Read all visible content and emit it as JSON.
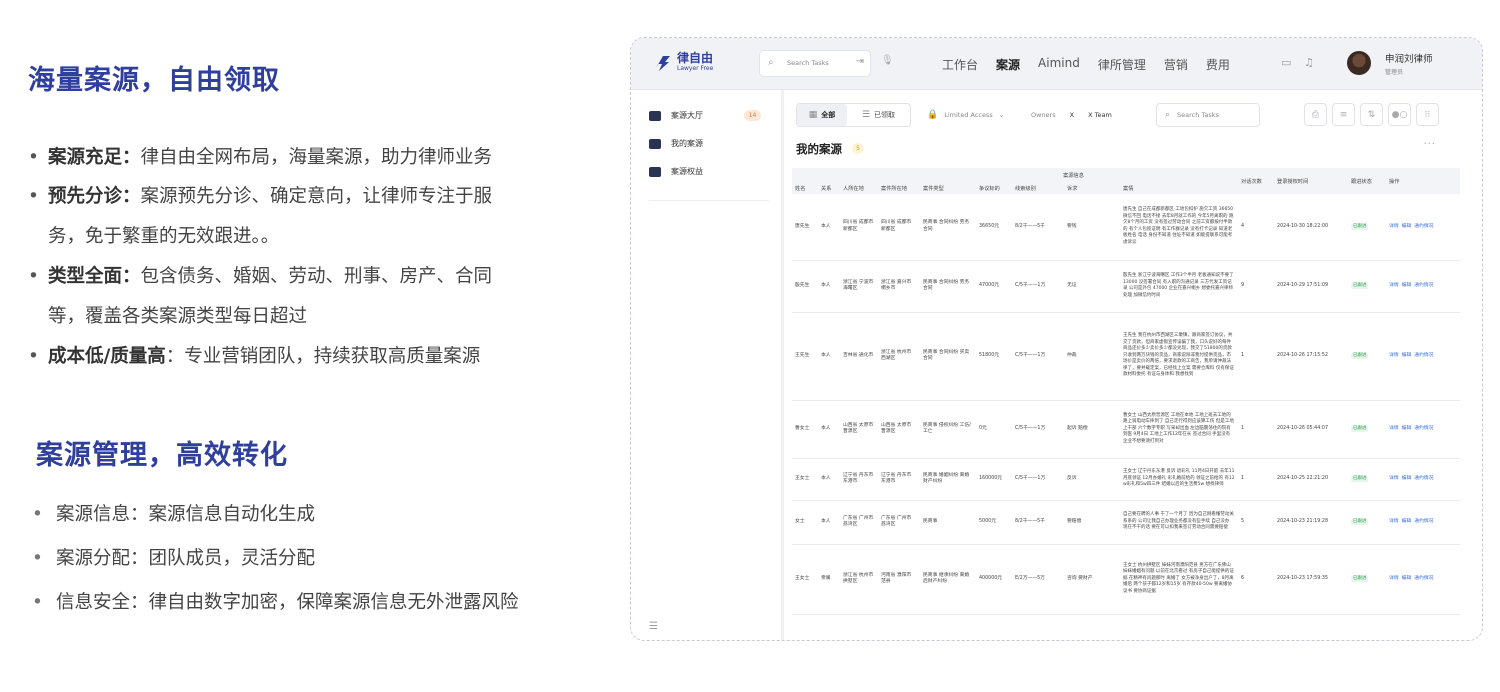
{
  "left": {
    "heading1": "海量案源，自由领取",
    "bullets": [
      {
        "bold": "案源充足：",
        "text": "律自由全网布局，海量案源，助力律师业务",
        "cont": ""
      },
      {
        "bold": "预先分诊：",
        "text": "案源预先分诊、确定意向，让律师专注于服",
        "cont": "务，免于繁重的无效跟进。。"
      },
      {
        "bold": "类型全面：",
        "text": "包含债务、婚姻、劳动、刑事、房产、合同",
        "cont": "等，覆盖各类案源类型每日超过"
      },
      {
        "bold": "成本低/质量高",
        "text": "：专业营销团队，持续获取高质量案源",
        "cont": ""
      }
    ],
    "heading2": "案源管理，高效转化",
    "sub_bullets": [
      "案源信息：案源信息自动化生成",
      "案源分配：团队成员，灵活分配",
      "信息安全：律自由数字加密，保障案源信息无外泄露风险"
    ]
  },
  "app": {
    "logo_name": "律自由",
    "logo_sub": "Lawyer Free",
    "search_placeholder": "Search Tasks",
    "nav": [
      "工作台",
      "案源",
      "Aimind",
      "律所管理",
      "营销",
      "费用"
    ],
    "user_name": "申润刘律师",
    "user_role": "管理员",
    "sidebar": [
      {
        "label": "案源大厅",
        "badge": "14"
      },
      {
        "label": "我的案源"
      },
      {
        "label": "案源权益"
      }
    ],
    "filters": {
      "all": "全部",
      "claimed": "已领取",
      "limited": "Limited Access",
      "owners": "Owners",
      "x": "X",
      "team": "X Team",
      "search_placeholder": "Search Tasks"
    },
    "title": "我的案源",
    "count": "5",
    "table": {
      "group_header": "案源信息",
      "headers": [
        "姓名",
        "关系",
        "人所在地",
        "案件所在地",
        "案件类型",
        "争议标的",
        "线索级别",
        "诉求",
        "案情",
        "对话次数",
        "登录授权时间",
        "跟进状态",
        "操作"
      ],
      "rows": [
        {
          "name": "唐先生",
          "rel": "本人",
          "loc": "四川省 成都市 新都区",
          "case_loc": "四川省 成都市 新都区",
          "type": "民商事 合同纠纷 劳务合同",
          "amount": "36650元",
          "level": "8/2千——5千",
          "demand": "要钱",
          "desc": "唐先生 自己在成都新都区 工地包扣护 施欠工资 36650 微信不回 电话不接 去年8月就工作的 今年5月离职的 跑欠8个月的工资 没有签过劳动合同 之前工资都按付半款的 有个人包揽证明 有工作群记录 没有打卡记录 知道老板姓名 电话 身份不知道 住址不知道 如能提联系可能考虑诉讼",
          "talks": "4",
          "time": "2024-10-30 18:22:00",
          "status": "已跟进",
          "ops": [
            "详情",
            "编辑",
            "通约情况"
          ]
        },
        {
          "name": "殷先生",
          "rel": "本人",
          "loc": "浙江省 宁波市 海曙区",
          "case_loc": "浙江省 嘉兴市 桐乡市",
          "type": "民商事 合同纠纷 劳务合同",
          "amount": "47000元",
          "level": "C/5千——1万",
          "demand": "无证",
          "desc": "殷先生 浙江宁波海曙区 工作3个半月 老板通知说不要了 13000 没签署合同 有入职的沟通记录 三方代发工资记录 公司是外包 47000 企业在嘉兴桐乡 想委托嘉兴律师处理 加微信约时间",
          "talks": "9",
          "time": "2024-10-29 17:51:09",
          "status": "已跟进",
          "ops": [
            "详情",
            "编辑",
            "通约情况"
          ]
        },
        {
          "name": "王先生",
          "rel": "本人",
          "loc": "吉林省 通化市",
          "case_loc": "浙江省 杭州市 西湖区",
          "type": "民商事 合同纠纷 买卖合同",
          "amount": "51800元",
          "level": "C/5千——1万",
          "demand": "仲裁",
          "desc": "王先生 我在杭州市西湖区三墩镇，跟商家签订协议，共交了货款，但商家虚假宣传误骗了我，口头说好的每件商品还价多少卖价多少都没兑现，我交了51800的货款只收到两万块钱的货品，商家说除非我付提供货品，市场价是卖价的两倍，要求退款的工商告，我单请仲裁法律了，要并载定案，已经找上立案 需要仓库料 仅有保证款材料委托 有证与身体和 我想找到",
          "talks": "1",
          "time": "2024-10-26 17:15:52",
          "status": "已跟进",
          "ops": [
            "详情",
            "编辑",
            "通约情况"
          ]
        },
        {
          "name": "曹女士",
          "rel": "本人",
          "loc": "山西省 太原市 晋源区",
          "case_loc": "山西省 太原市 晋源区",
          "type": "民商事 侵权纠纷 工伤/工亡",
          "amount": "0元",
          "level": "C/5千——1万",
          "demand": "起诉 赔偿",
          "desc": "曹女士 山西太原晋源区 工地在本地 工地上班去工地的路上骑电动车摔到了 自己走行得到应该算工伤 但是工地上干部 六个数字专职 写采却出血 左边脑震荡住的院有到医 9月4日 工地上工作12年在长 签过合同 手里没有 企业不想要请打到对",
          "talks": "1",
          "time": "2024-10-26 05:44:07",
          "status": "已跟进",
          "ops": [
            "详情",
            "编辑",
            "通约情况"
          ]
        },
        {
          "name": "王女士",
          "rel": "本人",
          "loc": "辽宁省 丹东市 东港市",
          "case_loc": "辽宁省 丹东市 东港市",
          "type": "民商事 婚姻纠纷 离婚财产纠纷",
          "amount": "160000元",
          "level": "C/5千——1万",
          "demand": "反诉",
          "desc": "王女士 辽宁丹东东港 反诉 退彩礼 11月4日开庭 去年11月底领证 12月办婚礼 彩礼婚前给的 领证之前给的 有12w彩礼和5w四三件 结婚以后的生活费5w 想找律师",
          "talks": "1",
          "time": "2024-10-25 22:21:20",
          "status": "已跟进",
          "ops": [
            "详情",
            "编辑",
            "通约情况"
          ]
        },
        {
          "name": "女士",
          "rel": "本人",
          "loc": "广东省 广州市 荔湾区",
          "case_loc": "广东省 广州市 荔湾区",
          "type": "民商事",
          "amount": "5000元",
          "level": "8/2千——5千",
          "demand": "要赔偿",
          "desc": "自己要在聘的人事 干了一个月了 因为自己刚看懂劳动关系系的 公司让我自己办理业务都没有些手续 自己没办 现在不干的话 要在可以扣我来签订劳动合同需要赔偿",
          "talks": "5",
          "time": "2024-10-23 21:19:28",
          "status": "已跟进",
          "ops": [
            "详情",
            "编辑",
            "通约情况"
          ]
        },
        {
          "name": "王女士",
          "rel": "亲属",
          "loc": "浙江省 杭州市 拱墅区",
          "case_loc": "河南省 濮阳市 范县",
          "type": "民商事 继承纠纷 离婚后财产纠纷",
          "amount": "400000元",
          "level": "E/2万——5万",
          "demand": "咨询 要财产",
          "desc": "王女士 杭州拱墅区 妹妹河南濮阳范县 男方在广东佛山 妹妹婚姻有问题 以前在北京看过 有房子自己能提供的证据 在精神有问题那时 离婚了 女方被净身出户了，8月离婚后 两个孩子都12岁和15岁 有存款40-50w 要离婚协议书 要协商证据",
          "talks": "6",
          "time": "2024-10-23 17:59:35",
          "status": "已跟进",
          "ops": [
            "详情",
            "编辑",
            "通约情况"
          ]
        }
      ]
    }
  },
  "colors": {
    "accent": "#2f3f9e",
    "link": "#3a6fdc",
    "status_bg": "#e5f6ea"
  }
}
